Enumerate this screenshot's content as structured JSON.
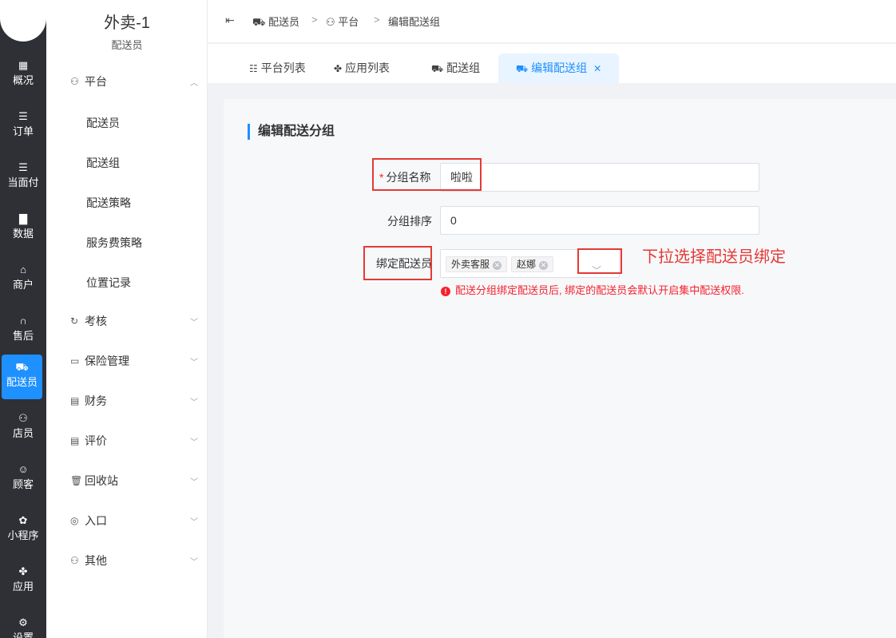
{
  "rail": {
    "items": [
      {
        "label": "概况",
        "icon": "grid-icon",
        "glyph": "▦"
      },
      {
        "label": "订单",
        "icon": "list-icon",
        "glyph": "☰"
      },
      {
        "label": "当面付",
        "icon": "list-icon",
        "glyph": "☰"
      },
      {
        "label": "数据",
        "icon": "bar-chart-icon",
        "glyph": "▇"
      },
      {
        "label": "商户",
        "icon": "store-icon",
        "glyph": "⌂"
      },
      {
        "label": "售后",
        "icon": "headset-icon",
        "glyph": "∩"
      },
      {
        "label": "配送员",
        "icon": "scooter-icon",
        "glyph": "⛟"
      },
      {
        "label": "店员",
        "icon": "users-icon",
        "glyph": "⚇"
      },
      {
        "label": "顾客",
        "icon": "user-circle-icon",
        "glyph": "☺"
      },
      {
        "label": "小程序",
        "icon": "wechat-icon",
        "glyph": "✿"
      },
      {
        "label": "应用",
        "icon": "apps-icon",
        "glyph": "✤"
      },
      {
        "label": "设置",
        "icon": "settings-icon",
        "glyph": "⚙"
      }
    ]
  },
  "submenu": {
    "title": "外卖-1",
    "subtitle": "配送员",
    "platform_group": "平台",
    "platform_children": [
      "配送员",
      "配送组",
      "配送策略",
      "服务费策略",
      "位置记录"
    ],
    "groups": [
      "考核",
      "保险管理",
      "财务",
      "评价",
      "回收站",
      "入口",
      "其他"
    ]
  },
  "breadcrumb": [
    "配送员",
    "平台",
    "编辑配送组"
  ],
  "tabs": [
    "平台列表",
    "应用列表",
    "配送组",
    "编辑配送组"
  ],
  "form": {
    "section_title": "编辑配送分组",
    "name_label": "分组名称",
    "name_value": "啦啦",
    "sort_label": "分组排序",
    "sort_value": "0",
    "bind_label": "绑定配送员",
    "tags": [
      "外卖客服",
      "赵娜"
    ],
    "hint": "配送分组绑定配送员后, 绑定的配送员会默认开启集中配送权限."
  },
  "annotation": "下拉选择配送员绑定",
  "colors": {
    "accent": "#1e90ff",
    "rail_bg": "#2e3035",
    "error": "#f5222d",
    "annotation": "#e53935"
  }
}
